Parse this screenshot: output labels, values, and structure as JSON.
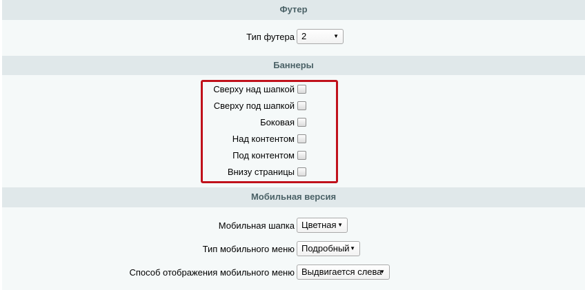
{
  "footer": {
    "heading": "Футер",
    "footer_type_label": "Тип футера",
    "footer_type_value": "2"
  },
  "banners": {
    "heading": "Баннеры",
    "items": [
      {
        "label": "Сверху над шапкой",
        "checked": false
      },
      {
        "label": "Сверху под шапкой",
        "checked": false
      },
      {
        "label": "Боковая",
        "checked": false
      },
      {
        "label": "Над контентом",
        "checked": false
      },
      {
        "label": "Под контентом",
        "checked": false
      },
      {
        "label": "Внизу страницы",
        "checked": false
      }
    ],
    "highlight_color": "#c0111b"
  },
  "mobile": {
    "heading": "Мобильная версия",
    "header_label": "Мобильная шапка",
    "header_value": "Цветная",
    "menu_type_label": "Тип мобильного меню",
    "menu_type_value": "Подробный",
    "menu_display_label": "Способ отображения мобильного меню",
    "menu_display_value": "Выдвигается слева"
  },
  "icons": {
    "dropdown_arrow": "chevron-down-icon"
  }
}
